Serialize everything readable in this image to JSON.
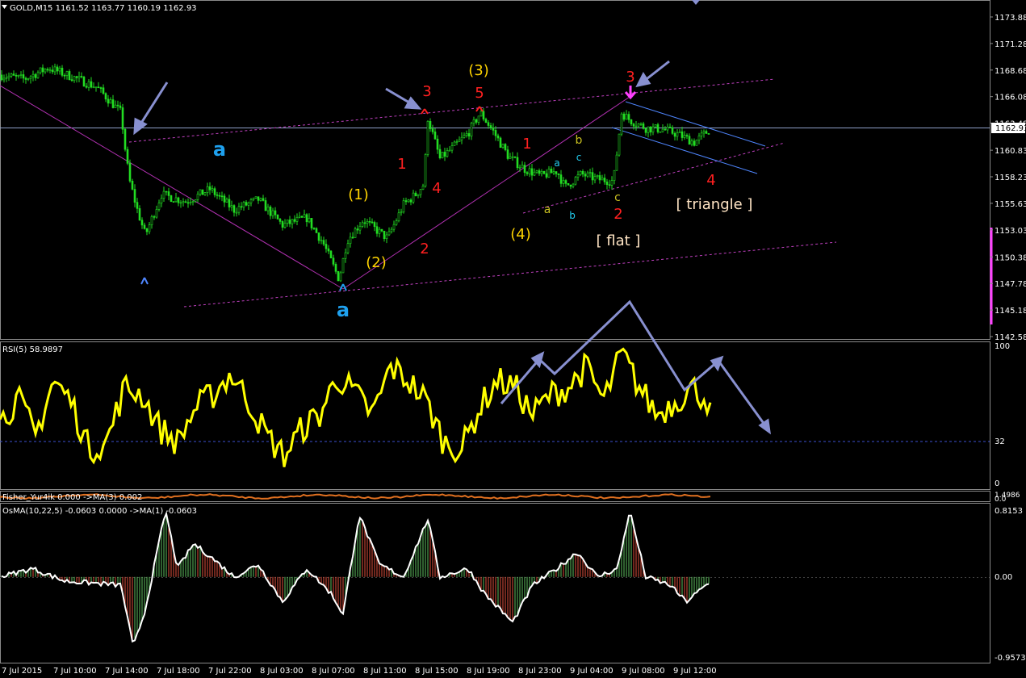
{
  "colors": {
    "background": "#000000",
    "candle": "#22dd22",
    "rsi": "#ffff00",
    "wave_red": "#ff2020",
    "wave_yellow": "#ffd400",
    "wave_blue": "#1ea0ee",
    "trendline": "#c040c0",
    "arrow": "#8890d0",
    "channel_blue": "#4f86ff",
    "osma_pos": "#5fbf5f",
    "osma_neg": "#e0503c",
    "axis_text": "#ffffff"
  },
  "header": {
    "main": "GOLD,M15  1161.52 1163.77 1160.19 1162.93",
    "rsi": "RSI(5) 58.9897",
    "fisher": "Fisher_Yur4ik 0.000  ->MA(3) 0.002",
    "osma": "OsMA(10,22,5) -0.0603 0.0000   ->MA(1) -0.0603"
  },
  "price_axis": {
    "ticks": [
      "1173.88",
      "1171.28",
      "1168.68",
      "1166.08",
      "1163.48",
      "1160.83",
      "1158.23",
      "1155.63",
      "1153.03",
      "1150.38",
      "1147.78",
      "1145.18",
      "1142.58"
    ],
    "current": "1162.93"
  },
  "rsi_axis": {
    "ticks": [
      "100",
      "32",
      "0"
    ]
  },
  "fisher_axis": {
    "ticks": [
      "1.4986",
      "0.0"
    ]
  },
  "osma_axis": {
    "ticks": [
      "0.8153",
      "0.00",
      "-0.9573"
    ]
  },
  "time_axis": {
    "labels": [
      "7 Jul 2015",
      "7 Jul 10:00",
      "7 Jul 14:00",
      "7 Jul 18:00",
      "7 Jul 22:00",
      "8 Jul 03:00",
      "8 Jul 07:00",
      "8 Jul 11:00",
      "8 Jul 15:00",
      "8 Jul 19:00",
      "8 Jul 23:00",
      "9 Jul 04:00",
      "9 Jul 08:00",
      "9 Jul 12:00"
    ]
  },
  "wave_labels": {
    "a_left": "a",
    "a_bottom": "a",
    "w1_paren": "(1)",
    "w2_paren": "(2)",
    "w3_paren": "(3)",
    "w4_paren": "(4)",
    "r1": "1",
    "r2": "2",
    "r3": "3",
    "r4": "4",
    "r5": "5",
    "r1b": "1",
    "r2b": "2",
    "r3b": "3",
    "r4b": "4",
    "sa1": "a",
    "sb1": "b",
    "sc1": "c",
    "sa2": "a",
    "sb2": "b",
    "sc2": "c",
    "flat": "[ flat ]",
    "triangle": "[ triangle ]"
  },
  "chart_data": [
    {
      "type": "candlestick",
      "series": "GOLD,M15",
      "ohlc_last": {
        "open": 1161.52,
        "high": 1163.77,
        "low": 1160.19,
        "close": 1162.93
      },
      "ylim": [
        1142.58,
        1173.88
      ],
      "path_x": [
        0,
        30,
        60,
        90,
        120,
        150,
        155,
        160,
        170,
        180,
        200,
        230,
        260,
        290,
        320,
        350,
        380,
        400,
        420,
        430,
        450,
        480,
        500,
        515,
        525,
        530,
        545,
        560,
        580,
        595,
        610,
        630,
        650,
        670,
        690,
        700,
        720,
        740,
        760,
        770,
        780,
        800,
        820,
        840,
        860,
        880
      ],
      "path_price": [
        1168.2,
        1167.8,
        1168.9,
        1168.0,
        1167.0,
        1164.5,
        1161.0,
        1158.0,
        1155.0,
        1152.5,
        1156.5,
        1155.8,
        1157.0,
        1155.0,
        1156.0,
        1153.5,
        1154.2,
        1151.8,
        1148.2,
        1152.0,
        1154.0,
        1152.2,
        1155.5,
        1156.5,
        1157.5,
        1164.0,
        1160.0,
        1161.0,
        1162.5,
        1164.5,
        1162.8,
        1160.2,
        1159.0,
        1158.3,
        1158.8,
        1157.2,
        1158.5,
        1158.0,
        1157.8,
        1164.5,
        1163.8,
        1163.0,
        1162.9,
        1162.4,
        1161.6,
        1162.9
      ]
    },
    {
      "type": "line",
      "series": "RSI(5)",
      "last": 58.9897,
      "ylim": [
        0,
        100
      ],
      "level": 32,
      "values_sample": [
        45,
        62,
        35,
        75,
        60,
        25,
        30,
        70,
        65,
        40,
        30,
        55,
        65,
        80,
        60,
        35,
        20,
        40,
        50,
        78,
        65,
        50,
        85,
        75,
        60,
        30,
        25,
        55,
        75,
        70,
        50,
        65,
        70,
        85,
        60,
        95,
        70,
        50,
        60,
        70,
        58.99
      ]
    },
    {
      "type": "histogram",
      "series": "OsMA(10,22,5)",
      "ylim": [
        -0.9573,
        0.8153
      ],
      "last": -0.0603
    }
  ]
}
